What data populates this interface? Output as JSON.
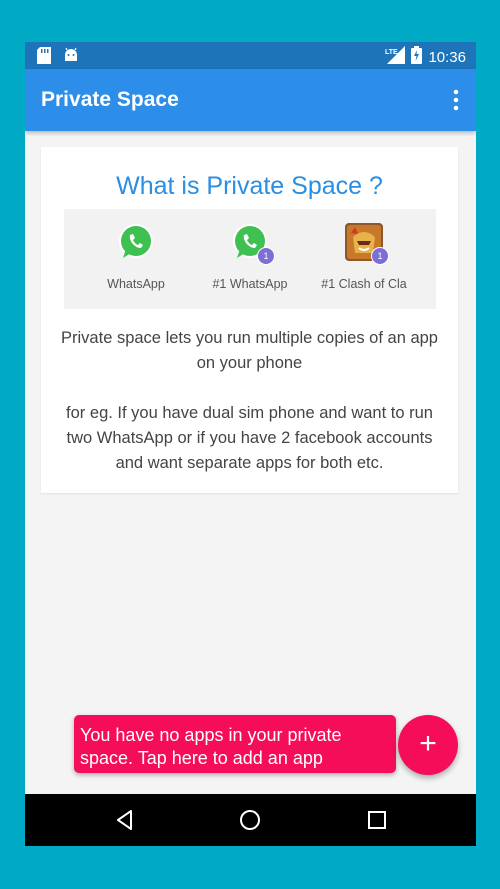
{
  "status_bar": {
    "time": "10:36",
    "network": "LTE",
    "icons": [
      "sd-card-icon",
      "android-icon",
      "lte-signal-icon",
      "battery-charging-icon"
    ]
  },
  "app_bar": {
    "title": "Private Space",
    "menu_icon": "overflow-menu-icon"
  },
  "card": {
    "title": "What is Private Space ?",
    "apps": [
      {
        "label": "WhatsApp",
        "icon": "whatsapp-icon",
        "badge": ""
      },
      {
        "label": "#1 WhatsApp",
        "icon": "whatsapp-icon",
        "badge": "1"
      },
      {
        "label": "#1 Clash of Cla",
        "icon": "clash-of-clans-icon",
        "badge": "1"
      }
    ],
    "paragraph1": "Private space lets you run multiple copies of an app on your phone",
    "paragraph2": "for eg. If you have dual sim phone and want to run two WhatsApp or if you have 2 facebook accounts and want separate apps for both etc."
  },
  "snackbar": {
    "text": "You have no apps in your private space. Tap here to add an app"
  },
  "fab": {
    "label": "+"
  },
  "nav_bar": {
    "icons": [
      "back-icon",
      "home-icon",
      "recents-icon"
    ]
  },
  "colors": {
    "app_bar": "#2c8ee8",
    "status_bar": "#1e74b8",
    "accent": "#f50d5a",
    "title_text": "#2a8ee3",
    "outer_background": "#00a9c4"
  }
}
